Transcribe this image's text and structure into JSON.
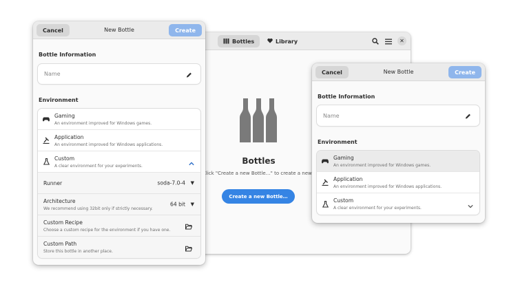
{
  "main_window": {
    "tabs": [
      {
        "label": "Bottles",
        "icon": "bottles-icon"
      },
      {
        "label": "Library",
        "icon": "heart-icon"
      }
    ],
    "header_icons": [
      "search-icon",
      "menu-icon",
      "close-icon"
    ],
    "title": "Bottles",
    "subtitle": "Click \"Create a new Bottle…\" to create a new bottle.",
    "create_button": "Create a new Bottle…"
  },
  "dialog_left": {
    "cancel": "Cancel",
    "title": "New Bottle",
    "create": "Create",
    "bottle_info_title": "Bottle Information",
    "name_placeholder": "Name",
    "environment_title": "Environment",
    "environments": [
      {
        "title": "Gaming",
        "subtitle": "An environment improved for Windows games.",
        "icon": "gamepad-icon"
      },
      {
        "title": "Application",
        "subtitle": "An environment improved for Windows applications.",
        "icon": "application-icon"
      },
      {
        "title": "Custom",
        "subtitle": "A clear environment for your experiments.",
        "icon": "flask-icon",
        "expanded": true
      }
    ],
    "custom_options": {
      "runner_label": "Runner",
      "runner_value": "soda-7.0-4",
      "arch_label": "Architecture",
      "arch_desc": "We recommend using 32bit only if strictly necessary.",
      "arch_value": "64 bit",
      "recipe_label": "Custom Recipe",
      "recipe_desc": "Choose a custom recipe for the environment if you have one.",
      "path_label": "Custom Path",
      "path_desc": "Store this bottle in another place."
    }
  },
  "dialog_right": {
    "cancel": "Cancel",
    "title": "New Bottle",
    "create": "Create",
    "bottle_info_title": "Bottle Information",
    "name_placeholder": "Name",
    "environment_title": "Environment",
    "environments": [
      {
        "title": "Gaming",
        "subtitle": "An environment improved for Windows games.",
        "icon": "gamepad-icon",
        "selected": true
      },
      {
        "title": "Application",
        "subtitle": "An environment improved for Windows applications.",
        "icon": "application-icon"
      },
      {
        "title": "Custom",
        "subtitle": "A clear environment for your experiments.",
        "icon": "flask-icon"
      }
    ]
  },
  "colors": {
    "accent": "#3584e4",
    "accent_disabled": "#8fb6ec",
    "headerbar": "#ebebeb",
    "window_bg": "#fafafa",
    "icon_gray": "#7a7a7a"
  }
}
